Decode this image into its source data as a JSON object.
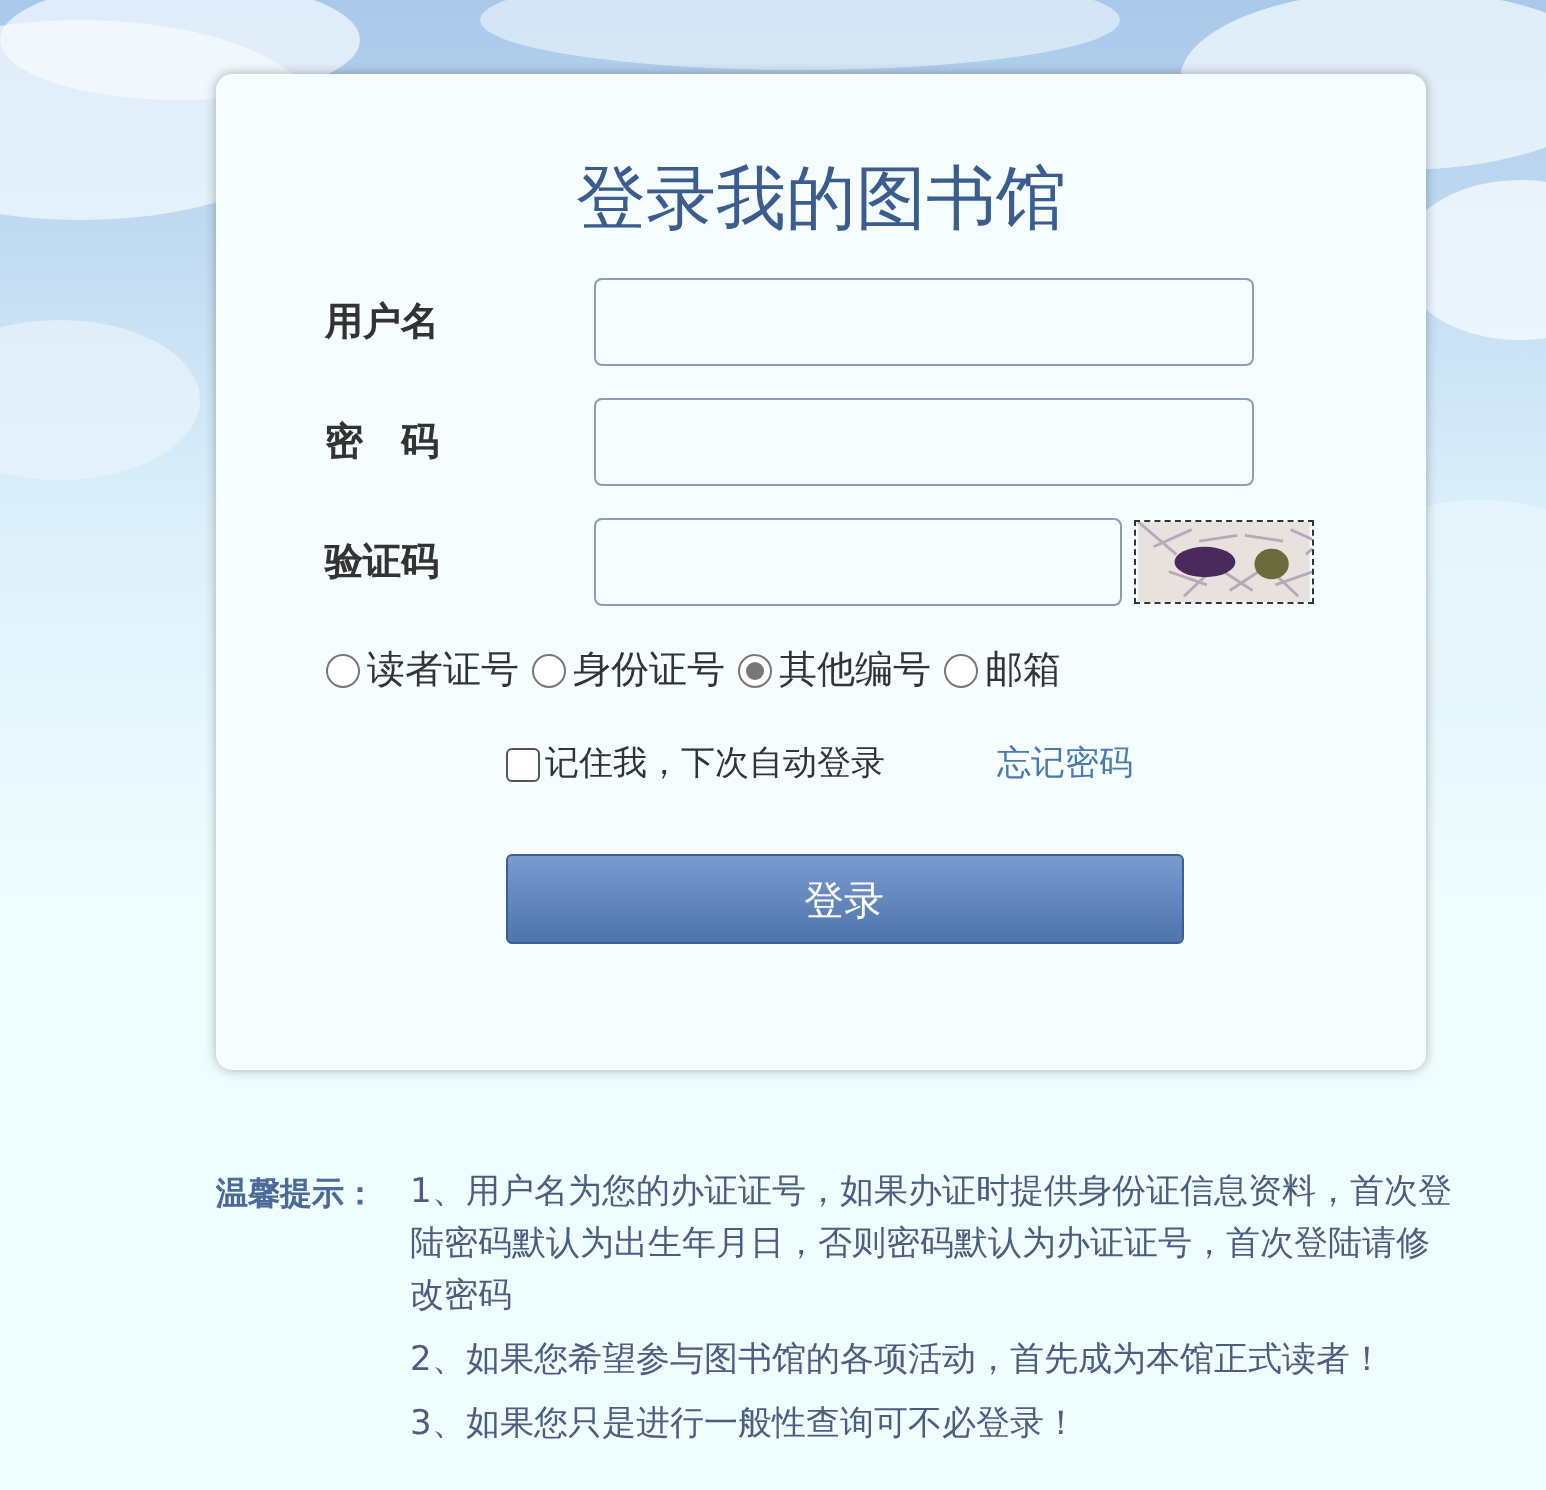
{
  "title": "登录我的图书馆",
  "fields": [
    {
      "label": "用户名",
      "kind": "text"
    },
    {
      "label": "密　码",
      "kind": "password"
    },
    {
      "label": "验证码",
      "kind": "captcha"
    }
  ],
  "login_type": [
    {
      "label": "读者证号",
      "selected": false
    },
    {
      "label": "身份证号",
      "selected": false
    },
    {
      "label": "其他编号",
      "selected": true
    },
    {
      "label": "邮箱",
      "selected": false
    }
  ],
  "remember": {
    "label": "记住我，下次自动登录",
    "checked": false
  },
  "forgot_link": "忘记密码",
  "login_button": "登录",
  "tips": {
    "label": "温馨提示：",
    "items": [
      "1、用户名为您的办证证号，如果办证时提供身份证信息资料，首次登陆密码默认为出生年月日，否则密码默认为办证证号，首次登陆请修改密码",
      "2、如果您希望参与图书馆的各项活动，首先成为本馆正式读者！",
      "3、如果您只是进行一般性查询可不必登录！"
    ]
  }
}
